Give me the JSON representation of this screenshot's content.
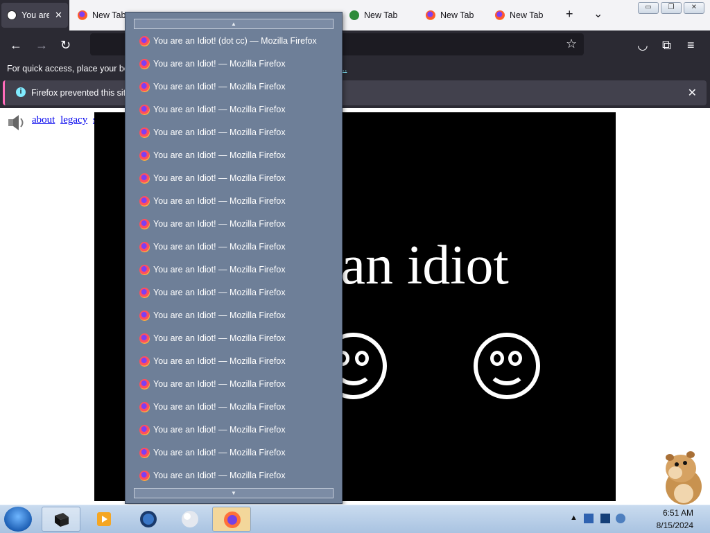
{
  "browser": {
    "tabs": [
      {
        "label": "You are an Idiot!",
        "active": true,
        "icon": "smiley-icon"
      },
      {
        "label": "New Tab",
        "active": false,
        "icon": "firefox-icon"
      },
      {
        "label": "New Tab",
        "active": false,
        "icon": "firefox-icon"
      },
      {
        "label": "New Tab",
        "active": false,
        "icon": "firefox-icon"
      },
      {
        "label": "New Tab",
        "active": false,
        "icon": "firefox-icon"
      }
    ],
    "active_tab_visible_text": "You are",
    "tab_close": "✕",
    "new_tab_button": "+",
    "list_all_tabs_button": "⌄",
    "window_controls": {
      "minimize": "▭",
      "restore": "❐",
      "close": "✕"
    },
    "nav": {
      "back": "←",
      "forward": "→",
      "reload": "↻",
      "bookmark_star": "☆",
      "pocket": "◡",
      "extensions": "⧉",
      "menu": "≡"
    },
    "bookmarks_hint": "For quick access, place your boo",
    "bookmarks_more": "...",
    "infobar": {
      "message": "Firefox prevented this site",
      "icon": "info-icon",
      "close": "✕"
    },
    "accent": "#42414d"
  },
  "page": {
    "links": [
      "about",
      "legacy",
      "safe"
    ],
    "big_text": "e an idiot",
    "faces": 2
  },
  "dropdown": {
    "scroll_up": "▲",
    "scroll_down": "▼",
    "items": [
      "You are an Idiot! (dot cc) — Mozilla Firefox",
      "You are an Idiot! — Mozilla Firefox",
      "You are an Idiot! — Mozilla Firefox",
      "You are an Idiot! — Mozilla Firefox",
      "You are an Idiot! — Mozilla Firefox",
      "You are an Idiot! — Mozilla Firefox",
      "You are an Idiot! — Mozilla Firefox",
      "You are an Idiot! — Mozilla Firefox",
      "You are an Idiot! — Mozilla Firefox",
      "You are an Idiot! — Mozilla Firefox",
      "You are an Idiot! — Mozilla Firefox",
      "You are an Idiot! — Mozilla Firefox",
      "You are an Idiot! — Mozilla Firefox",
      "You are an Idiot! — Mozilla Firefox",
      "You are an Idiot! — Mozilla Firefox",
      "You are an Idiot! — Mozilla Firefox",
      "You are an Idiot! — Mozilla Firefox",
      "You are an Idiot! — Mozilla Firefox",
      "You are an Idiot! — Mozilla Firefox",
      "You are an Idiot! — Mozilla Firefox"
    ]
  },
  "taskbar": {
    "time": "6:51 AM",
    "date": "8/15/2024",
    "show_hidden_icons": "▲"
  }
}
